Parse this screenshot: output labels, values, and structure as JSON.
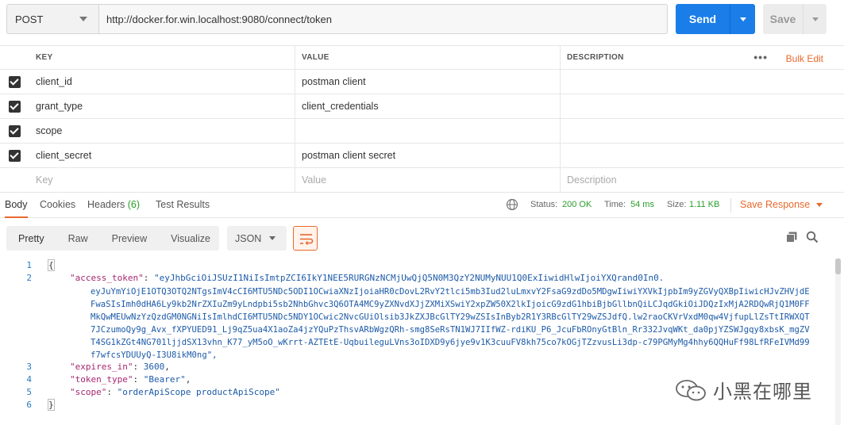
{
  "request": {
    "method": "POST",
    "url": "http://docker.for.win.localhost:9080/connect/token",
    "send_label": "Send",
    "save_label": "Save"
  },
  "params": {
    "headers": {
      "key": "KEY",
      "value": "VALUE",
      "description": "DESCRIPTION"
    },
    "bulk_edit": "Bulk Edit",
    "rows": [
      {
        "key": "client_id",
        "value": "postman client",
        "checked": true
      },
      {
        "key": "grant_type",
        "value": "client_credentials",
        "checked": true
      },
      {
        "key": "scope",
        "value": "",
        "checked": true
      },
      {
        "key": "client_secret",
        "value": "postman client secret",
        "checked": true
      }
    ],
    "placeholders": {
      "key": "Key",
      "value": "Value",
      "description": "Description"
    }
  },
  "response": {
    "tabs": [
      "Body",
      "Cookies",
      "Headers",
      "Test Results"
    ],
    "headers_count": "(6)",
    "status_label": "Status:",
    "status_value": "200 OK",
    "time_label": "Time:",
    "time_value": "54 ms",
    "size_label": "Size:",
    "size_value": "1.11 KB",
    "save_response": "Save Response",
    "view_modes": [
      "Pretty",
      "Raw",
      "Preview",
      "Visualize"
    ],
    "format": "JSON"
  },
  "body": {
    "line_numbers": [
      "1",
      "2",
      "3",
      "4",
      "5",
      "6"
    ],
    "open": "{",
    "close": "}",
    "access_token_key": "\"access_token\"",
    "access_token_lines": [
      "\"eyJhbGciOiJSUzI1NiIsImtpZCI6IkY1NEE5RURGNzNCMjUwQjQ5N0M3QzY2NUMyNUU1Q0ExIiwidHlwIjoiYXQrand0In0.",
      "eyJuYmYiOjE1OTQ3OTQ2NTgsImV4cCI6MTU5NDc5ODI1OCwiaXNzIjoiaHR0cDovL2RvY2tlci5mb3Iud2luLmxvY2FsaG9zdDo5MDgwIiwiYXVkIjpbIm9yZGVyQXBpIiwicHJvZHVjdEFwaSIsImh0dHA6Ly9kb2NrZXIuZm9yLndpbi5sb2NhbGhvc3Q6OTA4MC9yZXNvdXJjZXMiXSwiY2xpZW50X2lkIjoicG9zdG1hbiBjbGllbnQiLCJqdGkiOiJDQzIxMjA2RDQwRjQ1M0FFMkQwMEUwNzYzQzdGM0NGNiIsImlhdCI6MTU5NDc5NDY1OCwic2NvcGUiOlsib3JkZXJBcGlTY29wZSIsInByb2R1Y3RBcGlTY29wZSJdfQ.",
      "lw2raoCKVrVxdM0qw4VjfupLlZsTtIRWXQT7JCzumoQy9g_Avx_fXPYUED91_Lj9qZ5ua4X1aoZa4jzYQuPzThsvARbWgzQRh-smg8SeRsTN1WJ7IIfWZ-rdiKU_P6_JcuFbROnyGtBln_Rr332JvqWKt_da0pjYZSWJgqy8xbsK_mgZVT4SG1kZGt4NG701ljjdSX13vhn_K77_yM5oO_wKrrt-AZTEtE-UqbuileguLVns3oIDXD9y6jye9v1K3cuuFV8kh75co7kOGjTZzvusLi3dp-c79PGMyMg4hhy6QQHuFf98LfRFeIVMd99f7wfcsYDUUyQ-I3U8ikM0ng\""
    ],
    "expires_in_key": "\"expires_in\"",
    "expires_in_value": "3600",
    "token_type_key": "\"token_type\"",
    "token_type_value": "\"Bearer\"",
    "scope_key": "\"scope\"",
    "scope_value": "\"orderApiScope productApiScope\""
  },
  "watermark": "小黑在哪里"
}
